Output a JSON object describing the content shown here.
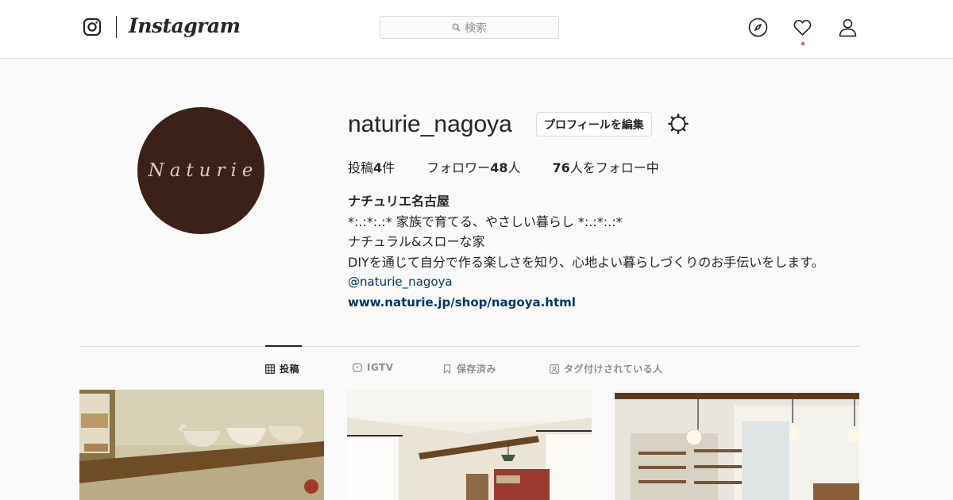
{
  "header": {
    "brand": "Instagram",
    "search_placeholder": "検索",
    "icons": [
      "instagram-glyph-icon",
      "search-icon",
      "compass-icon",
      "heart-icon",
      "person-icon"
    ]
  },
  "profile": {
    "username": "naturie_nagoya",
    "edit_label": "プロフィールを編集",
    "avatar_logo": "Naturie",
    "stats": {
      "posts_label": "投稿",
      "posts_count": "4",
      "posts_unit": "件",
      "followers_label": "フォロワー",
      "followers_count": "48",
      "followers_unit": "人",
      "following_count": "76",
      "following_label": "人をフォロー中"
    },
    "bio": {
      "name": "ナチュリエ名古屋",
      "line1": "*:.:*:.:* 家族で育てる、やさしい暮らし *:.:*:.:*",
      "line2": "ナチュラル&スローな家",
      "line3": "DIYを通じて自分で作る楽しさを知り、心地よい暮らしづくりのお手伝いをします。",
      "mention": "@naturie_nagoya",
      "website": "www.naturie.jp/shop/nagoya.html"
    }
  },
  "tabs": [
    {
      "label": "投稿",
      "active": true
    },
    {
      "label": "IGTV",
      "active": false
    },
    {
      "label": "保存済み",
      "active": false
    },
    {
      "label": "タグ付けされている人",
      "active": false
    }
  ],
  "colors": {
    "link": "#00376b",
    "avatar_bg": "#3b2118",
    "notification": "#ed4956",
    "muted": "#8e8e8e"
  }
}
